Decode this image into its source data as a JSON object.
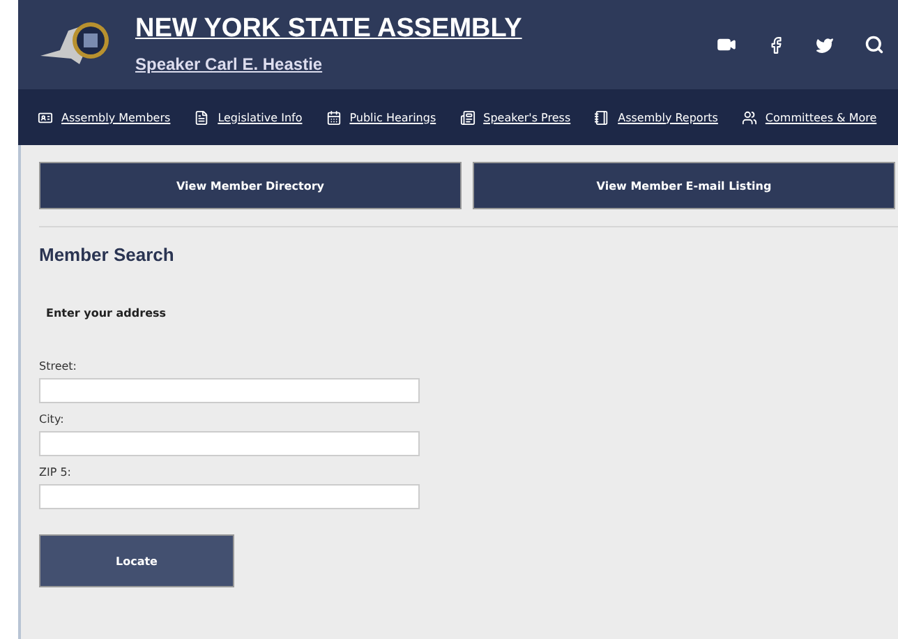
{
  "header": {
    "title": "NEW YORK STATE ASSEMBLY",
    "subtitle": "Speaker Carl E. Heastie"
  },
  "nav": [
    {
      "label": "Assembly Members",
      "kind": "members"
    },
    {
      "label": "Legislative Info",
      "kind": "file"
    },
    {
      "label": "Public Hearings",
      "kind": "calendar"
    },
    {
      "label": "Speaker's Press",
      "kind": "press"
    },
    {
      "label": "Assembly Reports",
      "kind": "report"
    },
    {
      "label": "Committees & More",
      "kind": "committees"
    }
  ],
  "actions": [
    "View Member Directory",
    "View Member E-mail Listing"
  ],
  "search": {
    "heading": "Member Search",
    "intro": "Enter your address",
    "fields": [
      {
        "label": "Street:"
      },
      {
        "label": "City:"
      },
      {
        "label": "ZIP 5:"
      }
    ],
    "button": "Locate"
  }
}
